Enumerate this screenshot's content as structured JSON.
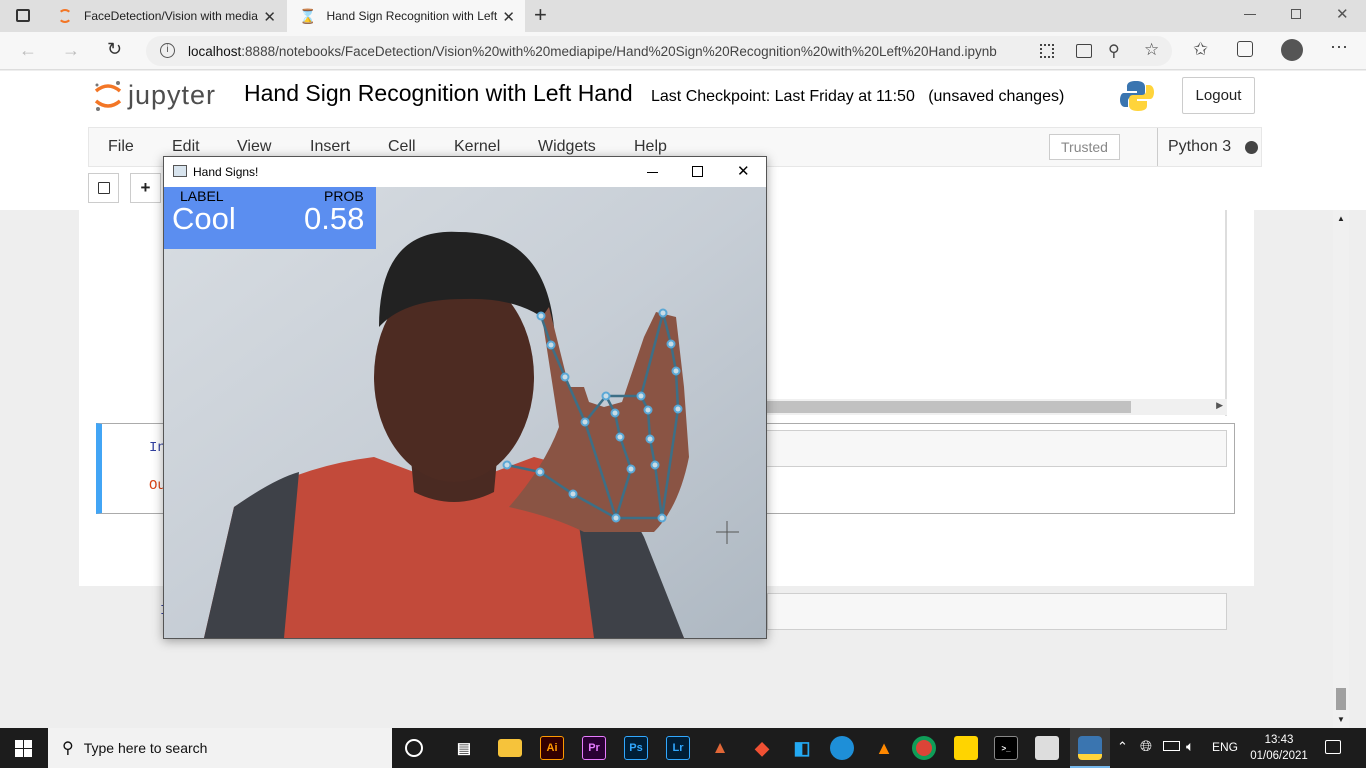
{
  "browser": {
    "tabs": [
      {
        "label": "FaceDetection/Vision with media"
      },
      {
        "label": "Hand Sign Recognition with Left"
      }
    ],
    "new_tab_symbol": "+",
    "url_host": "localhost",
    "url_rest": ":8888/notebooks/FaceDetection/Vision%20with%20mediapipe/Hand%20Sign%20Recognition%20with%20Left%20Hand.ipynb"
  },
  "jupyter": {
    "logo_text": "jupyter",
    "notebook_title": "Hand Sign Recognition with Left Hand",
    "checkpoint": "Last Checkpoint: Last Friday at 11:50",
    "unsaved": "(unsaved changes)",
    "logout_label": "Logout",
    "menu": [
      "File",
      "Edit",
      "View",
      "Insert",
      "Cell",
      "Kernel",
      "Widgets",
      "Help"
    ],
    "trusted_label": "Trusted",
    "kernel_name": "Python 3",
    "cell_prompts": {
      "in": "In",
      "out": "Ou",
      "in2": "I"
    }
  },
  "cv_window": {
    "title": "Hand Signs!",
    "label_header": "LABEL",
    "prob_header": "PROB",
    "label_value": "Cool",
    "prob_value": "0.58",
    "overlay_color": "#5b8ef0",
    "landmark_color": "#5ba8d6"
  },
  "taskbar": {
    "search_placeholder": "Type here to search",
    "language": "ENG",
    "time": "13:43",
    "date": "01/06/2021",
    "apps": [
      "task-view",
      "file-explorer",
      "illustrator",
      "premiere",
      "photoshop",
      "lightroom",
      "matlab",
      "git",
      "vscode",
      "edge",
      "vlc",
      "chrome",
      "sticky-notes",
      "terminal",
      "image-viewer",
      "python"
    ]
  }
}
